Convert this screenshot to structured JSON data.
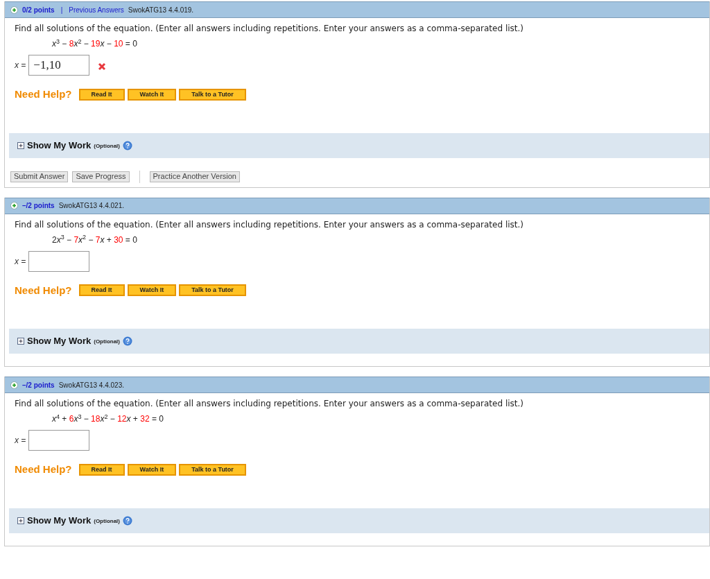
{
  "questions": [
    {
      "points": "0/2 points",
      "separator": "|",
      "link": "Previous Answers",
      "code": "SwokATG13 4.4.019.",
      "prompt": "Find all solutions of the equation. (Enter all answers including repetitions. Enter your answers as a comma-separated list.)",
      "equation": [
        {
          "text": "x",
          "kind": "var"
        },
        {
          "text": "3",
          "kind": "exp"
        },
        {
          "text": " − ",
          "kind": "op"
        },
        {
          "text": "8",
          "kind": "coef"
        },
        {
          "text": "x",
          "kind": "var"
        },
        {
          "text": "2",
          "kind": "exp"
        },
        {
          "text": " − ",
          "kind": "op"
        },
        {
          "text": "19",
          "kind": "coef"
        },
        {
          "text": "x",
          "kind": "var"
        },
        {
          "text": " − ",
          "kind": "op"
        },
        {
          "text": "10",
          "kind": "coef"
        },
        {
          "text": " = 0",
          "kind": "op"
        }
      ],
      "answer_label": "x =",
      "answer": "−1,10",
      "incorrect": true,
      "help_label": "Need Help?",
      "help_buttons": [
        "Read It",
        "Watch It",
        "Talk to a Tutor"
      ],
      "work_label": "Show My Work",
      "work_note": "(Optional)",
      "actions": [
        "Submit Answer",
        "Save Progress"
      ],
      "practice": "Practice Another Version"
    },
    {
      "points": "–/2 points",
      "code": "SwokATG13 4.4.021.",
      "prompt": "Find all solutions of the equation. (Enter all answers including repetitions. Enter your answers as a comma-separated list.)",
      "equation": [
        {
          "text": "2",
          "kind": "num"
        },
        {
          "text": "x",
          "kind": "var"
        },
        {
          "text": "3",
          "kind": "exp"
        },
        {
          "text": " − ",
          "kind": "op"
        },
        {
          "text": "7",
          "kind": "coef"
        },
        {
          "text": "x",
          "kind": "var"
        },
        {
          "text": "2",
          "kind": "exp"
        },
        {
          "text": " − ",
          "kind": "op"
        },
        {
          "text": "7",
          "kind": "coef"
        },
        {
          "text": "x",
          "kind": "var"
        },
        {
          "text": " + ",
          "kind": "op"
        },
        {
          "text": "30",
          "kind": "coef"
        },
        {
          "text": " = 0",
          "kind": "op"
        }
      ],
      "answer_label": "x =",
      "incorrect": false,
      "help_label": "Need Help?",
      "help_buttons": [
        "Read It",
        "Watch It",
        "Talk to a Tutor"
      ],
      "work_label": "Show My Work",
      "work_note": "(Optional)"
    },
    {
      "points": "–/2 points",
      "code": "SwokATG13 4.4.023.",
      "prompt": "Find all solutions of the equation. (Enter all answers including repetitions. Enter your answers as a comma-separated list.)",
      "equation": [
        {
          "text": "x",
          "kind": "var"
        },
        {
          "text": "4",
          "kind": "exp"
        },
        {
          "text": " + ",
          "kind": "op"
        },
        {
          "text": "6",
          "kind": "coef"
        },
        {
          "text": "x",
          "kind": "var"
        },
        {
          "text": "3",
          "kind": "exp"
        },
        {
          "text": " − ",
          "kind": "op"
        },
        {
          "text": "18",
          "kind": "coef"
        },
        {
          "text": "x",
          "kind": "var"
        },
        {
          "text": "2",
          "kind": "exp"
        },
        {
          "text": " − ",
          "kind": "op"
        },
        {
          "text": "12",
          "kind": "coef"
        },
        {
          "text": "x",
          "kind": "var"
        },
        {
          "text": " + ",
          "kind": "op"
        },
        {
          "text": "32",
          "kind": "coef"
        },
        {
          "text": " = 0",
          "kind": "op"
        }
      ],
      "answer_label": "x =",
      "incorrect": false,
      "help_label": "Need Help?",
      "help_buttons": [
        "Read It",
        "Watch It",
        "Talk to a Tutor"
      ],
      "work_label": "Show My Work",
      "work_note": "(Optional)"
    }
  ]
}
